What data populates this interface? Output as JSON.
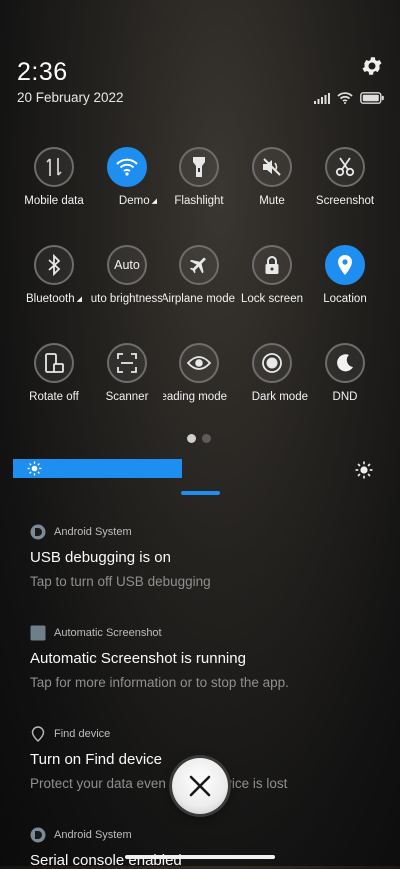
{
  "status": {
    "time": "2:36",
    "date": "20 February 2022"
  },
  "tiles": [
    {
      "label": "Mobile data",
      "active": false,
      "arrow": false
    },
    {
      "label": "Demo",
      "active": true,
      "arrow": true
    },
    {
      "label": "Flashlight",
      "active": false,
      "arrow": false
    },
    {
      "label": "Mute",
      "active": false,
      "arrow": false
    },
    {
      "label": "Screenshot",
      "active": false,
      "arrow": false
    },
    {
      "label": "Bluetooth",
      "active": false,
      "arrow": true
    },
    {
      "label": "Auto brightness",
      "active": false,
      "arrow": false,
      "circle_text": "Auto"
    },
    {
      "label": "Airplane mode",
      "active": false,
      "arrow": false
    },
    {
      "label": "Lock screen",
      "active": false,
      "arrow": false
    },
    {
      "label": "Location",
      "active": true,
      "arrow": false
    },
    {
      "label": "Rotate off",
      "active": false,
      "arrow": false
    },
    {
      "label": "Scanner",
      "active": false,
      "arrow": false
    },
    {
      "label": "Reading mode",
      "active": false,
      "arrow": false
    },
    {
      "label": "Dark mode",
      "active": false,
      "arrow": false
    },
    {
      "label": "DND",
      "active": false,
      "arrow": false
    }
  ],
  "brightness": {
    "level": 0.52
  },
  "notifications": [
    {
      "source": "Android System",
      "title": "USB debugging is on",
      "body": "Tap to turn off USB debugging"
    },
    {
      "source": "Automatic Screenshot",
      "title": "Automatic Screenshot is running",
      "body": "Tap for more information or to stop the app."
    },
    {
      "source": "Find device",
      "title": "Turn on Find device",
      "body": "Protect your data even if your device is lost"
    },
    {
      "source": "Android System",
      "title": "Serial console enabled",
      "body": ""
    }
  ],
  "colors": {
    "accent": "#1e8ef0"
  }
}
